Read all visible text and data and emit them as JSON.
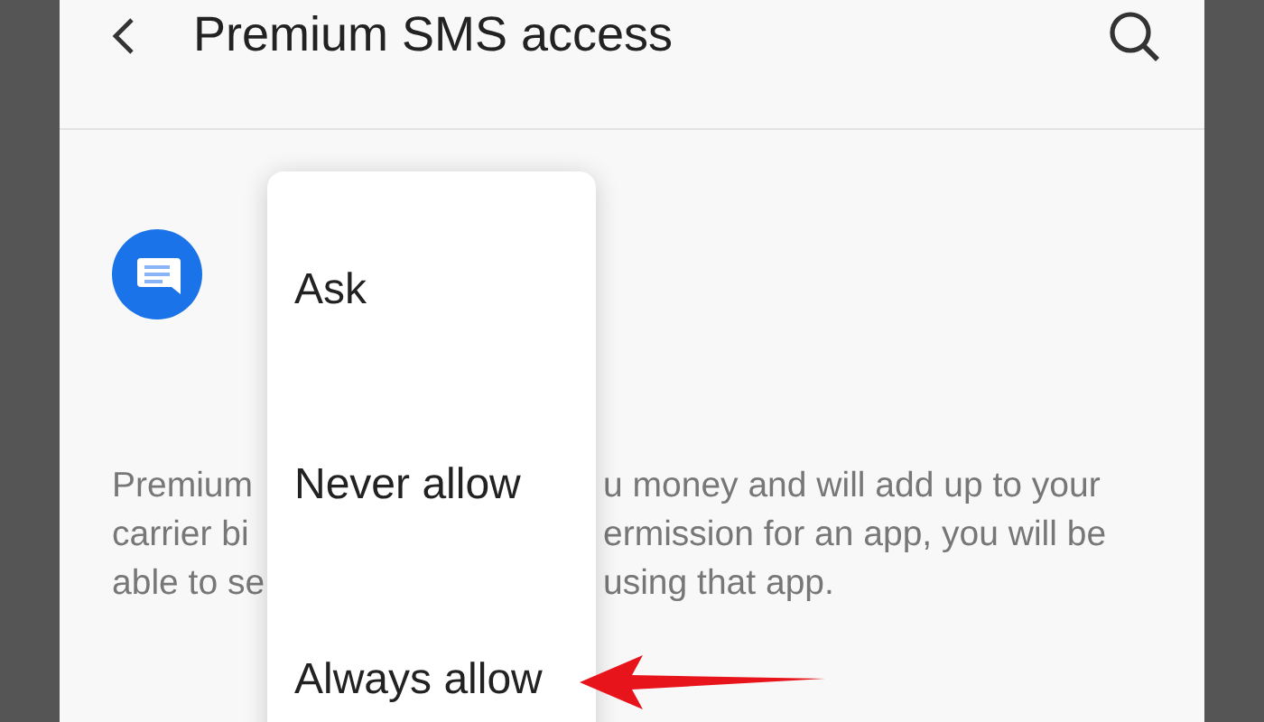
{
  "app_bar": {
    "title": "Premium SMS access"
  },
  "description_lines": [
    {
      "left": "Premium",
      "right": "u money and will add up to your"
    },
    {
      "left": "carrier bi",
      "right": "ermission for an app, you will be"
    },
    {
      "left": "able to se",
      "right": "using that app."
    }
  ],
  "menu": {
    "items": [
      {
        "label": "Ask"
      },
      {
        "label": "Never allow"
      },
      {
        "label": "Always allow"
      }
    ]
  }
}
